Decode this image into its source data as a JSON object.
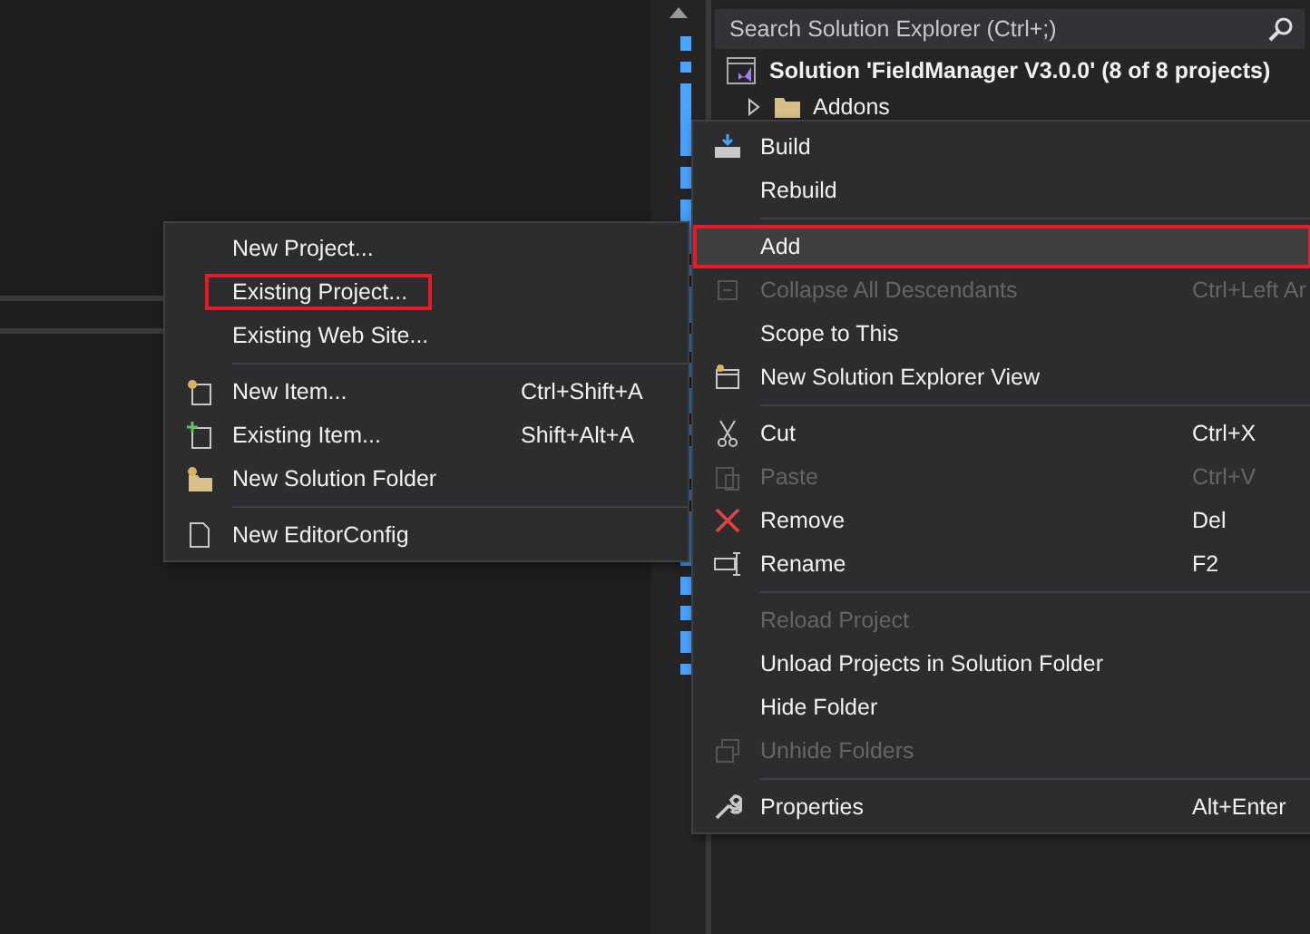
{
  "explorer": {
    "search": {
      "placeholder": "Search Solution Explorer (Ctrl+;)"
    },
    "tree": [
      {
        "label": "Solution 'FieldManager V3.0.0' (8 of 8 projects)",
        "kind": "solution",
        "children": [
          {
            "label": "Addons",
            "kind": "folder",
            "expanded": false
          }
        ]
      }
    ]
  },
  "context_menu": {
    "items": [
      {
        "kind": "item",
        "label": "Build",
        "disabled": false,
        "selected": false,
        "highlighted": false
      },
      {
        "kind": "item",
        "label": "Rebuild",
        "disabled": false,
        "selected": false,
        "highlighted": false
      },
      {
        "kind": "separator"
      },
      {
        "kind": "item",
        "label": "Add",
        "disabled": false,
        "selected": true,
        "highlighted": true
      },
      {
        "kind": "item",
        "label": "Collapse All Descendants",
        "shortcut": "Ctrl+Left Ar",
        "disabled": true,
        "selected": false,
        "highlighted": false
      },
      {
        "kind": "item",
        "label": "Scope to This",
        "disabled": false,
        "selected": false,
        "highlighted": false
      },
      {
        "kind": "item",
        "label": "New Solution Explorer View",
        "disabled": false,
        "selected": false,
        "highlighted": false
      },
      {
        "kind": "separator"
      },
      {
        "kind": "item",
        "label": "Cut",
        "shortcut": "Ctrl+X",
        "disabled": false,
        "selected": false,
        "highlighted": false
      },
      {
        "kind": "item",
        "label": "Paste",
        "shortcut": "Ctrl+V",
        "disabled": true,
        "selected": false,
        "highlighted": false
      },
      {
        "kind": "item",
        "label": "Remove",
        "shortcut": "Del",
        "disabled": false,
        "selected": false,
        "highlighted": false
      },
      {
        "kind": "item",
        "label": "Rename",
        "shortcut": "F2",
        "disabled": false,
        "selected": false,
        "highlighted": false
      },
      {
        "kind": "separator"
      },
      {
        "kind": "item",
        "label": "Reload Project",
        "disabled": true,
        "selected": false,
        "highlighted": false
      },
      {
        "kind": "item",
        "label": "Unload Projects in Solution Folder",
        "disabled": false,
        "selected": false,
        "highlighted": false
      },
      {
        "kind": "item",
        "label": "Hide Folder",
        "disabled": false,
        "selected": false,
        "highlighted": false
      },
      {
        "kind": "item",
        "label": "Unhide Folders",
        "disabled": true,
        "selected": false,
        "highlighted": false
      },
      {
        "kind": "separator"
      },
      {
        "kind": "item",
        "label": "Properties",
        "shortcut": "Alt+Enter",
        "disabled": false,
        "selected": false,
        "highlighted": false
      }
    ]
  },
  "submenu": {
    "items": [
      {
        "kind": "item",
        "label": "New Project...",
        "disabled": false,
        "selected": false,
        "highlighted": false
      },
      {
        "kind": "item",
        "label": "Existing Project...",
        "disabled": false,
        "selected": false,
        "highlighted": true
      },
      {
        "kind": "item",
        "label": "Existing Web Site...",
        "disabled": false,
        "selected": false,
        "highlighted": false
      },
      {
        "kind": "separator"
      },
      {
        "kind": "item",
        "label": "New Item...",
        "shortcut": "Ctrl+Shift+A",
        "disabled": false,
        "selected": false,
        "highlighted": false
      },
      {
        "kind": "item",
        "label": "Existing Item...",
        "shortcut": "Shift+Alt+A",
        "disabled": false,
        "selected": false,
        "highlighted": false
      },
      {
        "kind": "item",
        "label": "New Solution Folder",
        "disabled": false,
        "selected": false,
        "highlighted": false
      },
      {
        "kind": "separator"
      },
      {
        "kind": "item",
        "label": "New EditorConfig",
        "disabled": false,
        "selected": false,
        "highlighted": false
      }
    ]
  }
}
